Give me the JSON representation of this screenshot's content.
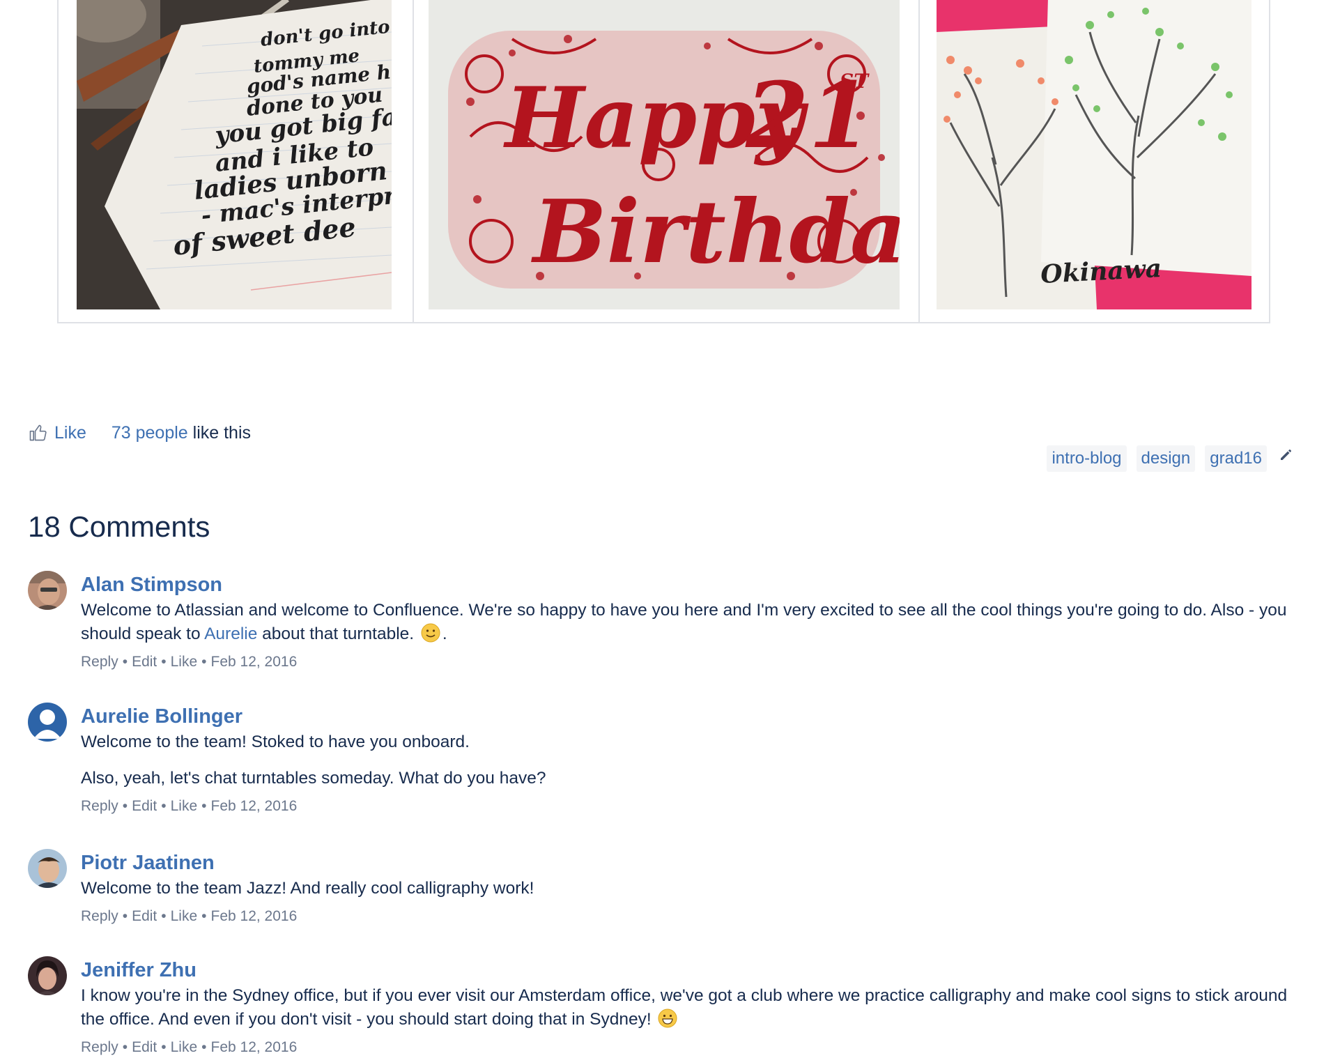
{
  "gallery": {
    "images": [
      {
        "name": "calligraphy-notebook-photo",
        "alt": "Calligraphy on lined notebook paper with dip pens"
      },
      {
        "name": "happy-birthday-lettering-photo",
        "alt": "Red hand-lettered Happy 21st Birthday with floral ornaments"
      },
      {
        "name": "tree-cards-photo",
        "alt": "Illustrated tree cards on pink background"
      }
    ],
    "notebook_lines": [
      "don't go into th",
      "tommy me",
      "god's name h",
      "done to you",
      "you got big fa",
      "and i like to",
      "ladies unborn",
      "- mac's interpret",
      "of sweet dee"
    ],
    "birthday_words": [
      "Happy",
      "21",
      "ST",
      "Birthday"
    ],
    "card_text": "Okinawa"
  },
  "likes": {
    "like_label": "Like",
    "count_link": "73 people",
    "suffix": " like this"
  },
  "labels": [
    "intro-blog",
    "design",
    "grad16"
  ],
  "comments_title": "18 Comments",
  "comments": [
    {
      "author": "Alan Stimpson",
      "text_before": "Welcome to Atlassian and welcome to Confluence. We're so happy to have you here and I'm very excited to see all the cool things you're going to do. Also - you should speak to ",
      "mention": "Aurelie",
      "text_after": " about that turntable. ",
      "text_end": ".",
      "actions": {
        "reply": "Reply",
        "edit": "Edit",
        "like": "Like",
        "date": "Feb 12, 2016"
      }
    },
    {
      "author": "Aurelie Bollinger",
      "paragraph1": "Welcome to the team! Stoked to have you onboard.",
      "paragraph2": "Also, yeah, let's chat turntables someday. What do you have?",
      "actions": {
        "reply": "Reply",
        "edit": "Edit",
        "like": "Like",
        "date": "Feb 12, 2016"
      }
    },
    {
      "author": "Piotr Jaatinen",
      "text": "Welcome to the team Jazz! And really cool calligraphy work!",
      "actions": {
        "reply": "Reply",
        "edit": "Edit",
        "like": "Like",
        "date": "Feb 12, 2016"
      }
    },
    {
      "author": "Jeniffer Zhu",
      "text": "I know you're in the Sydney office, but if you ever visit our Amsterdam office, we've got a club where we practice calligraphy and make cool signs to stick around the office. And even if you don't visit - you should start doing that in Sydney! ",
      "actions": {
        "reply": "Reply",
        "edit": "Edit",
        "like": "Like",
        "date": "Feb 12, 2016"
      }
    }
  ],
  "action_separator": "•",
  "colors": {
    "link": "#3e70b2",
    "text": "#172B4D",
    "meta": "#6b778c",
    "label_bg": "#f4f5f7",
    "border": "#dfe1e6",
    "birthday_red": "#b3141e",
    "card_pink": "#e8336b"
  }
}
